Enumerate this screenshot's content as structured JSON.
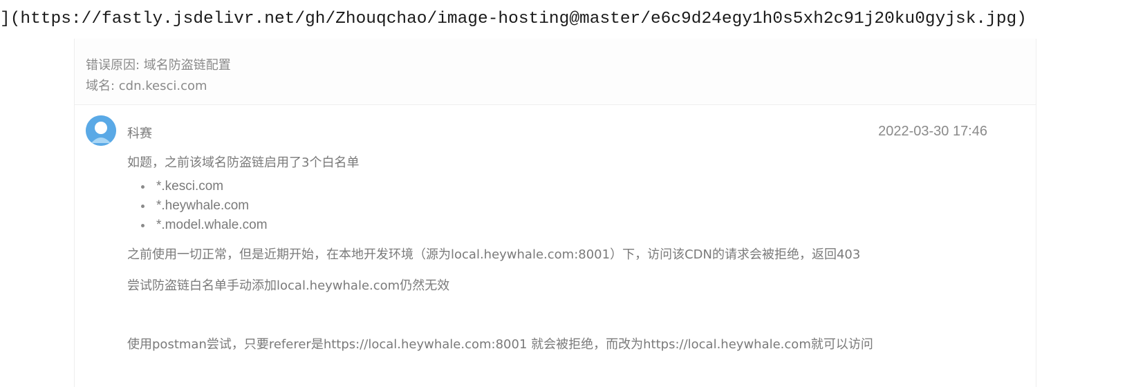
{
  "header": {
    "url_line": "](https://fastly.jsdelivr.net/gh/Zhouqchao/image-hosting@master/e6c9d24egy1h0s5xh2c91j20ku0gyjsk.jpg)"
  },
  "error": {
    "reason": "错误原因: 域名防盗链配置",
    "domain": "域名: cdn.kesci.com"
  },
  "comment": {
    "author": "科赛",
    "timestamp": "2022-03-30 17:46",
    "intro": "如题，之前该域名防盗链启用了3个白名单",
    "whitelist": [
      "*.kesci.com",
      "*.heywhale.com",
      "*.model.whale.com"
    ],
    "para_2": "之前使用一切正常，但是近期开始，在本地开发环境（源为local.heywhale.com:8001）下，访问该CDN的请求会被拒绝，返回403",
    "para_3": "尝试防盗链白名单手动添加local.heywhale.com仍然无效",
    "para_4": "使用postman尝试，只要referer是https://local.heywhale.com:8001 就会被拒绝，而改为https://local.heywhale.com就可以访问"
  },
  "colors": {
    "avatar": "#5aa9e6",
    "text": "#7a7a7a"
  },
  "icons": {
    "avatar": "user-avatar-icon"
  }
}
